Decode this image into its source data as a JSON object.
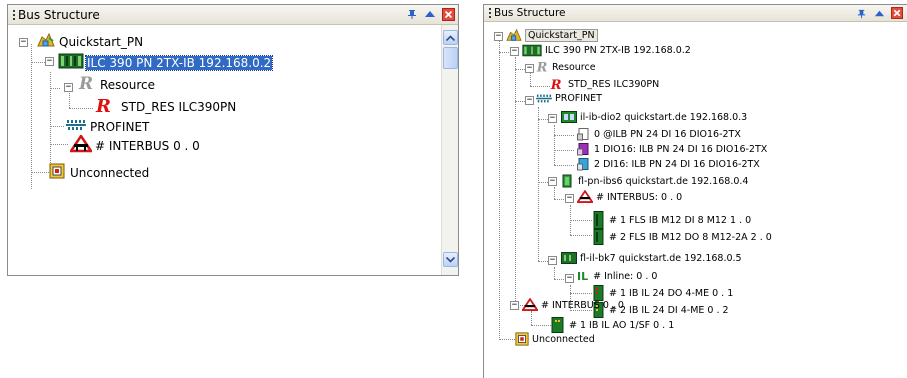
{
  "left_panel": {
    "title": "Bus Structure",
    "tree": {
      "root": "Quickstart_PN",
      "controller": "ILC 390 PN 2TX-IB 192.168.0.2",
      "resource": "Resource",
      "resource_child": "STD_RES ILC390PN",
      "profinet": "PROFINET",
      "interbus": "# INTERBUS 0 . 0",
      "unconnected": "Unconnected"
    }
  },
  "right_panel": {
    "title": "Bus Structure",
    "tree": {
      "root": "Quickstart_PN",
      "controller": "ILC 390 PN 2TX-IB 192.168.0.2",
      "resource": "Resource",
      "resource_child": "STD_RES ILC390PN",
      "profinet": "PROFINET",
      "dev1": "il-ib-dio2 quickstart.de 192.168.0.3",
      "dev1_items": [
        "0 @ILB PN 24 DI 16 DIO16-2TX",
        "1 DIO16: ILB PN 24 DI 16 DIO16-2TX",
        "2 DI16: ILB PN 24 DI 16 DIO16-2TX"
      ],
      "dev2": "fl-pn-ibs6 quickstart.de 192.168.0.4",
      "dev2_bus": "# INTERBUS: 0 . 0",
      "dev2_items": [
        "# 1 FLS IB M12 DI 8 M12 1 . 0",
        "# 2 FLS IB M12 DO 8 M12-2A 2 . 0"
      ],
      "dev3": "fl-il-bk7 quickstart.de 192.168.0.5",
      "dev3_bus": "# Inline: 0 . 0",
      "dev3_items": [
        "# 1 IB IL 24 DO 4-ME 0 . 1",
        "# 2 IB IL 24 DI 4-ME 0 . 2"
      ],
      "interbus": "# INTERBUS 0 . 0",
      "interbus_items": [
        "# 1 IB IL AO 1/SF 0 . 1"
      ],
      "unconnected": "Unconnected"
    }
  },
  "colors": {
    "selection": "#316ac5",
    "titlebar_pin": "#2b62c9",
    "close": "#d93a2b",
    "resource_red": "#e01010",
    "device_green": "#1f8a2c"
  }
}
